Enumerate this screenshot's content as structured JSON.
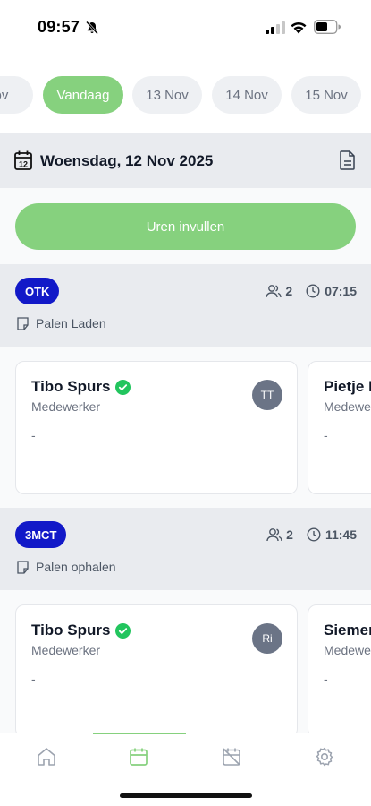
{
  "status_bar": {
    "time": "09:57"
  },
  "date_chips": [
    {
      "label": "Nov",
      "active": false
    },
    {
      "label": "Vandaag",
      "active": true
    },
    {
      "label": "13 Nov",
      "active": false
    },
    {
      "label": "14 Nov",
      "active": false
    },
    {
      "label": "15 Nov",
      "active": false
    }
  ],
  "day_header": {
    "title": "Woensdag, 12 Nov 2025",
    "calendar_icon_day": "12"
  },
  "cta": {
    "label": "Uren invullen"
  },
  "projects": [
    {
      "badge": "OTK",
      "people_count": "2",
      "time": "07:15",
      "task": "Palen Laden",
      "cards": [
        {
          "name": "Tibo Spurs",
          "role": "Medewerker",
          "note": "-",
          "avatar": "TT",
          "verified": true
        },
        {
          "name": "Pietje P",
          "role": "Medewe",
          "note": "-"
        }
      ]
    },
    {
      "badge": "3MCT",
      "people_count": "2",
      "time": "11:45",
      "task": "Palen ophalen",
      "cards": [
        {
          "name": "Tibo Spurs",
          "role": "Medewerker",
          "note": "-",
          "avatar": "Ri",
          "verified": true
        },
        {
          "name": "Siemen",
          "role": "Medewe",
          "note": "-"
        }
      ]
    }
  ],
  "tab_bar": {
    "items": [
      "home-icon",
      "calendar-icon",
      "calendar-off-icon",
      "settings-icon"
    ],
    "active_index": 1,
    "active_color": "#86d17e"
  },
  "colors": {
    "accent": "#86d17e",
    "badge": "#1219c8",
    "check": "#22c55e"
  }
}
